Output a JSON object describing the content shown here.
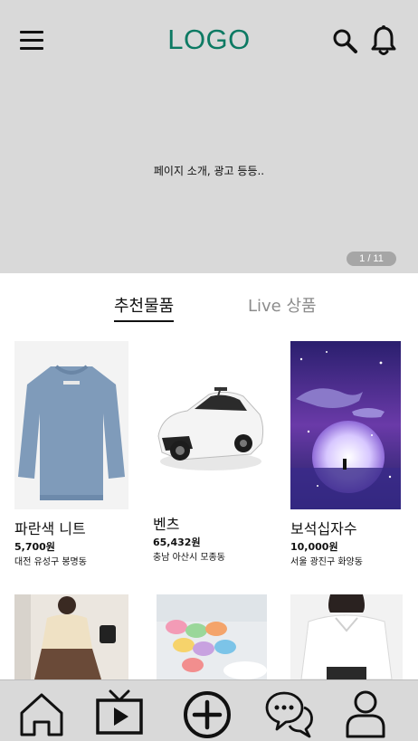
{
  "header": {
    "logo": "LOGO",
    "menu_icon": "hamburger-menu-icon",
    "search_icon": "search-icon",
    "bell_icon": "bell-icon"
  },
  "banner": {
    "text": "페이지 소개, 광고 등등..",
    "pager": "1 / 11"
  },
  "tabs": [
    {
      "label": "추천물품",
      "active": true
    },
    {
      "label": "Live 상품",
      "active": false
    }
  ],
  "products": [
    {
      "name": "파란색 니트",
      "price": "5,700원",
      "location": "대전 유성구 봉명동"
    },
    {
      "name": "벤츠",
      "price": "65,432원",
      "location": "충남 아산시 모종동"
    },
    {
      "name": "보석십자수",
      "price": "10,000원",
      "location": "서울 광진구 화양동"
    }
  ],
  "tabbar": {
    "items": [
      {
        "icon": "home-icon"
      },
      {
        "icon": "live-tv-icon"
      },
      {
        "icon": "add-circle-icon"
      },
      {
        "icon": "chat-icon"
      },
      {
        "icon": "profile-icon"
      }
    ]
  },
  "colors": {
    "logo": "#0d7a63",
    "header_bg": "#d9d9d9",
    "tabbar_bg": "#d9d9d9"
  }
}
